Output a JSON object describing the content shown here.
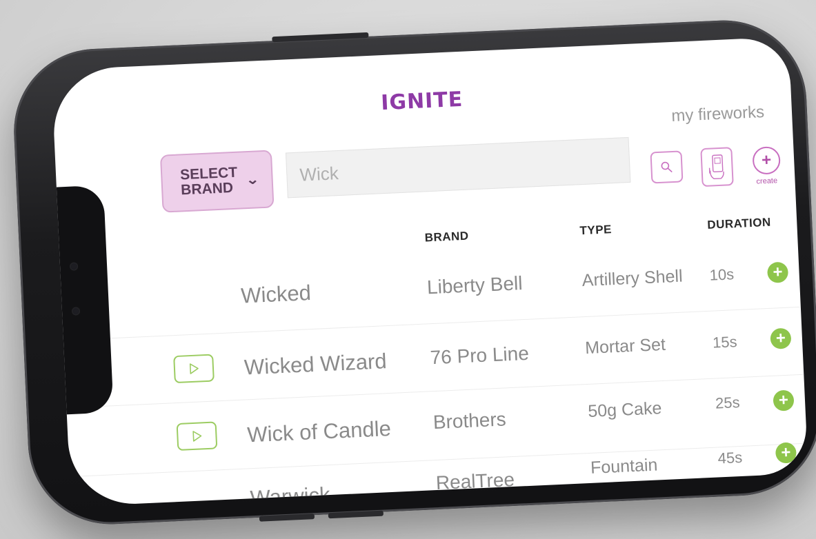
{
  "app": {
    "logo": "IGNITE",
    "nav_link": "my fireworks"
  },
  "toolbar": {
    "select_brand_label": "SELECT\nBRAND",
    "search_value": "Wick",
    "create_label": "create"
  },
  "colors": {
    "brand_purple": "#8e3aa6",
    "pink_accent": "#eed0ea",
    "green_accent": "#8ec54b"
  },
  "table": {
    "columns": [
      "BRAND",
      "TYPE",
      "DURATION"
    ],
    "rows": [
      {
        "name": "Wicked",
        "brand": "Liberty Bell",
        "type": "Artillery Shell",
        "duration": "10s",
        "has_video": false
      },
      {
        "name": "Wicked Wizard",
        "brand": "76 Pro Line",
        "type": "Mortar Set",
        "duration": "15s",
        "has_video": true
      },
      {
        "name": "Wick of Candle",
        "brand": "Brothers",
        "type": "50g Cake",
        "duration": "25s",
        "has_video": true
      },
      {
        "name": "Warwick",
        "brand": "RealTree",
        "type": "Fountain",
        "duration": "45s",
        "has_video": false
      }
    ]
  }
}
